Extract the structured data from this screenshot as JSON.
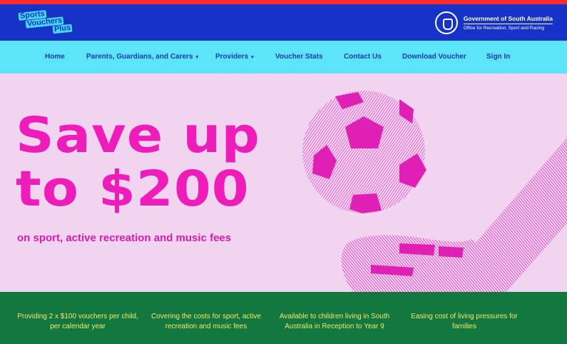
{
  "brand": {
    "logo_line1": "Sports",
    "logo_line2": "Vouchers",
    "logo_line3": "Plus",
    "gov_name": "Government of South Australia",
    "gov_office": "Office for Recreation, Sport and Racing"
  },
  "nav": {
    "items": [
      {
        "label": "Home",
        "icon": ""
      },
      {
        "label": "Parents, Guardians, and Carers",
        "icon": "chevron-down-icon"
      },
      {
        "label": "Providers",
        "icon": "chevron-down-icon"
      },
      {
        "label": "Voucher Stats",
        "icon": ""
      },
      {
        "label": "Contact Us",
        "icon": ""
      },
      {
        "label": "Download Voucher",
        "icon": ""
      },
      {
        "label": "Sign In",
        "icon": ""
      }
    ],
    "caret": "▾"
  },
  "hero": {
    "headline_line1": "Save up",
    "headline_line2": "to $200",
    "subheading": "on sport, active recreation and music fees"
  },
  "features": [
    "Providing 2 x $100 vouchers per child, per calendar year",
    "Covering the costs for sport, active recreation and music fees",
    "Available to children living in South Australia in Reception to Year 9",
    "Easing cost of living pressures for families"
  ],
  "colors": {
    "top_strip": "#ff2a2a",
    "header_bg": "#1632c7",
    "nav_bg": "#5ce4f8",
    "hero_bg": "#f1d4f0",
    "accent_pink": "#ee1cb8",
    "features_bg": "#12783f",
    "features_text": "#f7e86a"
  }
}
